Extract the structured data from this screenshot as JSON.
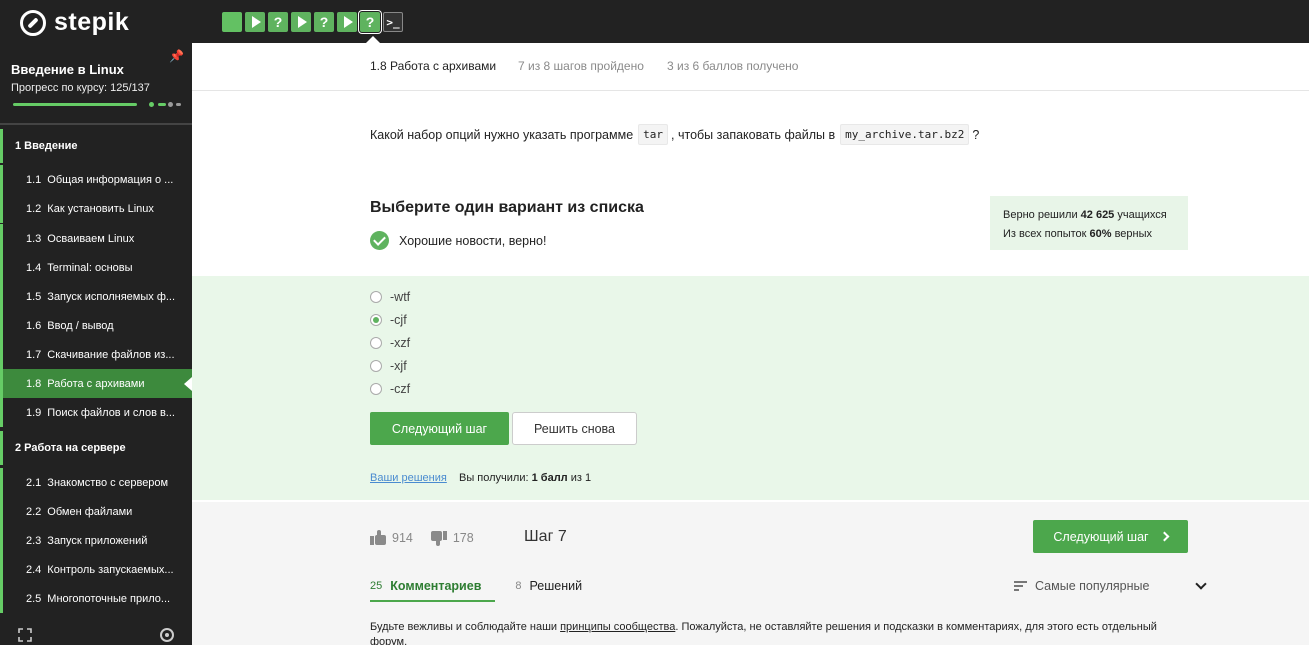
{
  "brand": {
    "name": "stepik"
  },
  "step_nav": {
    "items": [
      {
        "kind": "text",
        "icon": "text-step-icon"
      },
      {
        "kind": "video",
        "icon": "play-icon"
      },
      {
        "kind": "quiz",
        "icon": "question-icon",
        "label": "?"
      },
      {
        "kind": "video",
        "icon": "play-icon"
      },
      {
        "kind": "quiz",
        "icon": "question-icon",
        "label": "?"
      },
      {
        "kind": "video",
        "icon": "play-icon"
      },
      {
        "kind": "quiz",
        "icon": "question-icon",
        "label": "?",
        "current": true
      },
      {
        "kind": "code",
        "icon": "terminal-icon",
        "label": ">_"
      }
    ]
  },
  "sidebar": {
    "course_title": "Введение в Linux",
    "progress_label": "Прогресс по курсу:  125/137",
    "progress": {
      "done": 125,
      "total": 137
    },
    "modules": [
      {
        "title": "1  Введение",
        "lessons": [
          {
            "num": "1.1",
            "label": "Общая информация о ..."
          },
          {
            "num": "1.2",
            "label": "Как установить Linux"
          },
          {
            "num": "1.3",
            "label": "Осваиваем Linux"
          },
          {
            "num": "1.4",
            "label": "Terminal: основы"
          },
          {
            "num": "1.5",
            "label": "Запуск исполняемых ф..."
          },
          {
            "num": "1.6",
            "label": "Ввод / вывод"
          },
          {
            "num": "1.7",
            "label": "Скачивание файлов из..."
          },
          {
            "num": "1.8",
            "label": "Работа с архивами",
            "active": true
          },
          {
            "num": "1.9",
            "label": "Поиск файлов и слов в..."
          }
        ]
      },
      {
        "title": "2  Работа на сервере",
        "lessons": [
          {
            "num": "2.1",
            "label": "Знакомство с сервером"
          },
          {
            "num": "2.2",
            "label": "Обмен файлами"
          },
          {
            "num": "2.3",
            "label": "Запуск приложений"
          },
          {
            "num": "2.4",
            "label": "Контроль запускаемых..."
          },
          {
            "num": "2.5",
            "label": "Многопоточные прило..."
          }
        ]
      }
    ]
  },
  "lesson_header": {
    "title": "1.8 Работа с архивами",
    "steps_passed": "7 из 8 шагов пройдено",
    "points": "3 из 6 баллов  получено"
  },
  "question": {
    "before": "Какой набор опций нужно указать программе",
    "code1": "tar",
    "middle": ", чтобы запаковать файлы в",
    "code2": "my_archive.tar.bz2",
    "after": "?"
  },
  "quiz": {
    "title": "Выберите один вариант из списка",
    "result_text": "Хорошие новости, верно!",
    "stats": {
      "line1_pre": "Верно решили ",
      "line1_num": "42 625",
      "line1_post": " учащихся",
      "line2_pre": "Из всех попыток ",
      "line2_num": "60%",
      "line2_post": " верных"
    },
    "options": [
      {
        "label": "-wtf",
        "selected": false
      },
      {
        "label": "-cjf",
        "selected": true
      },
      {
        "label": "-xzf",
        "selected": false
      },
      {
        "label": "-xjf",
        "selected": false
      },
      {
        "label": "-czf",
        "selected": false
      }
    ],
    "next_button": "Следующий шаг",
    "retry_button": "Решить снова",
    "your_solutions": "Ваши решения",
    "score_pre": "Вы получили: ",
    "score_bold": "1 балл",
    "score_post": " из 1"
  },
  "footer": {
    "likes": "914",
    "dislikes": "178",
    "step_label": "Шаг 7",
    "next_button": "Следующий шаг",
    "tabs": [
      {
        "count": "25",
        "label": "Комментариев",
        "active": true
      },
      {
        "count": "8",
        "label": "Решений",
        "active": false
      }
    ],
    "sort_label": "Самые популярные",
    "rules_pre": "Будьте вежливы и соблюдайте наши ",
    "rules_link": "принципы сообщества",
    "rules_post": ". Пожалуйста, не оставляйте решения и подсказки в комментариях, для этого есть отдельный форум."
  },
  "colors": {
    "accent": "#4ca74c",
    "sidebar_bg": "#222222",
    "answer_bg": "#e9f7e9"
  }
}
